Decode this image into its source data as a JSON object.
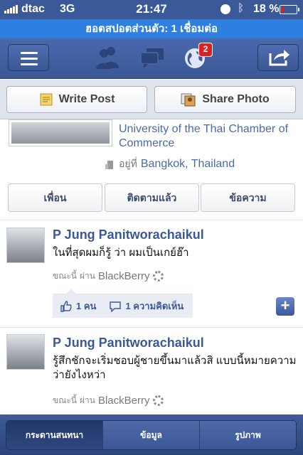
{
  "status_bar": {
    "carrier": "dtac",
    "network": "3G",
    "time": "21:47",
    "battery_percent": "18 %",
    "battery_level": 0.18
  },
  "hotspot_banner": "ฮอตสปอตส่วนตัว: 1 เชื่อมต่อ",
  "nav": {
    "notification_count": "2"
  },
  "actions": {
    "write_post": "Write Post",
    "share_photo": "Share Photo"
  },
  "profile": {
    "education": "University of the Thai Chamber of Commerce",
    "location_prefix": "อยู่ที่",
    "location": "Bangkok, Thailand"
  },
  "profile_tabs": [
    "เพื่อน",
    "ติดตามแล้ว",
    "ข้อความ"
  ],
  "posts": [
    {
      "author": "P Jung Panitworachaikul",
      "text": "ในที่สุดผมก็รู้ ว่า ผมเป็นเกย์ฮ๊า",
      "time_prefix": "ขณะนี้",
      "via_prefix": "ผ่าน",
      "via": "BlackBerry",
      "likes": "1 คน",
      "comments": "1 ความคิดเห็น"
    },
    {
      "author": "P Jung Panitworachaikul",
      "text": "รู้สึกชักจะเริ่มชอบผู้ชายขึ้นมาแล้วสิ แบบนี้หมายความว่ายังไงหว่า",
      "time_prefix": "ขณะนี้",
      "via_prefix": "ผ่าน",
      "via": "BlackBerry"
    }
  ],
  "bottom_tabs": [
    "กระดานสนทนา",
    "ข้อมูล",
    "รูปภาพ"
  ],
  "colors": {
    "facebook_blue": "#3b5998",
    "hotspot_blue": "#2d7fe0",
    "badge_red": "#e0201f"
  }
}
